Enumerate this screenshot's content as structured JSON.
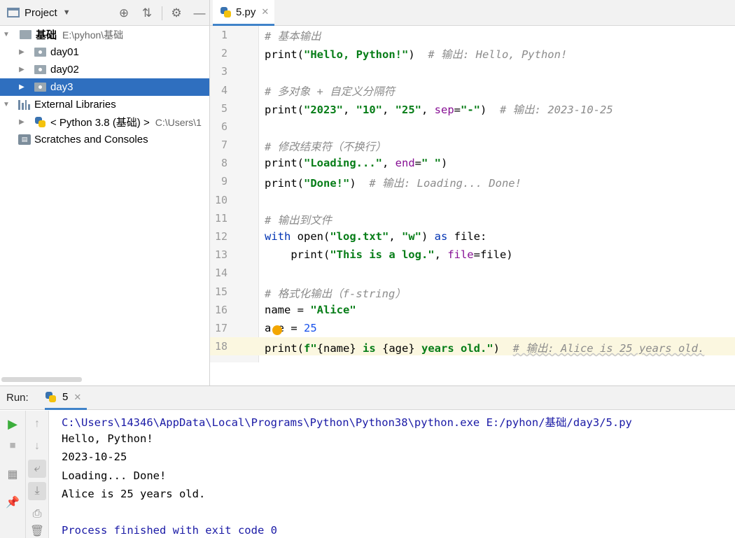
{
  "project_panel": {
    "title": "Project",
    "tree": [
      {
        "label": "基础",
        "path": "E:\\pyhon\\基础",
        "expanded": true
      },
      {
        "label": "day01"
      },
      {
        "label": "day02"
      },
      {
        "label": "day3",
        "selected": true
      },
      {
        "label": "External Libraries"
      },
      {
        "label": "< Python 3.8 (基础) >",
        "path": "C:\\Users\\1"
      },
      {
        "label": "Scratches and Consoles"
      }
    ]
  },
  "editor": {
    "tab_name": "5.py",
    "line_numbers": [
      "1",
      "2",
      "3",
      "4",
      "5",
      "6",
      "7",
      "8",
      "9",
      "10",
      "11",
      "12",
      "13",
      "14",
      "15",
      "16",
      "17",
      "18"
    ],
    "current_line": 18,
    "code": {
      "l1_comment": "# 基本输出",
      "l2_fn": "print(",
      "l2_str": "\"Hello, Python!\"",
      "l2_close": ")  ",
      "l2_comment": "# 输出: Hello, Python!",
      "l4_comment": "# 多对象 + 自定义分隔符",
      "l5_fn": "print(",
      "l5_s1": "\"2023\"",
      "l5_c1": ", ",
      "l5_s2": "\"10\"",
      "l5_c2": ", ",
      "l5_s3": "\"25\"",
      "l5_c3": ", ",
      "l5_kw": "sep",
      "l5_eq": "=",
      "l5_s4": "\"-\"",
      "l5_close": ")  ",
      "l5_comment": "# 输出: 2023-10-25",
      "l7_comment": "# 修改结束符（不换行）",
      "l8_fn": "print(",
      "l8_s1": "\"Loading...\"",
      "l8_c1": ", ",
      "l8_kw": "end",
      "l8_eq": "=",
      "l8_s2": "\" \"",
      "l8_close": ")",
      "l9_fn": "print(",
      "l9_s1": "\"Done!\"",
      "l9_close": ")  ",
      "l9_comment": "# 输出: Loading... Done!",
      "l11_comment": "# 输出到文件",
      "l12_with": "with",
      "l12_open": " open(",
      "l12_s1": "\"log.txt\"",
      "l12_c1": ", ",
      "l12_s2": "\"w\"",
      "l12_close": ") ",
      "l12_as": "as",
      "l12_rest": " file:",
      "l13_indent": "    print(",
      "l13_s1": "\"This is a log.\"",
      "l13_c1": ", ",
      "l13_kw": "file",
      "l13_rest": "=file)",
      "l15_comment": "# 格式化输出（f-string）",
      "l16_name": "name = ",
      "l16_s1": "\"Alice\"",
      "l17_a": "a",
      "l17_e": "e",
      "l17_eq": " = ",
      "l17_num": "25",
      "l18_fn": "print(",
      "l18_f": "f\"",
      "l18_v1": "{name}",
      "l18_m1": " is ",
      "l18_v2": "{age}",
      "l18_m2": " years old.\"",
      "l18_close": ")  ",
      "l18_comment": "# 输出: Alice is 25 years old."
    }
  },
  "run_panel": {
    "label": "Run:",
    "tab_name": "5",
    "output": [
      "C:\\Users\\14346\\AppData\\Local\\Programs\\Python\\Python38\\python.exe E:/pyhon/基础/day3/5.py",
      "Hello, Python!",
      "2023-10-25",
      "Loading... Done!",
      "Alice is 25 years old.",
      "",
      "Process finished with exit code 0"
    ]
  },
  "colors": {
    "selection": "#2f6fbf",
    "keyword": "#0033b3",
    "string": "#067d17",
    "number": "#1750eb",
    "kwarg": "#871094",
    "comment": "#8c8c8c",
    "run_green": "#3cae3c"
  }
}
